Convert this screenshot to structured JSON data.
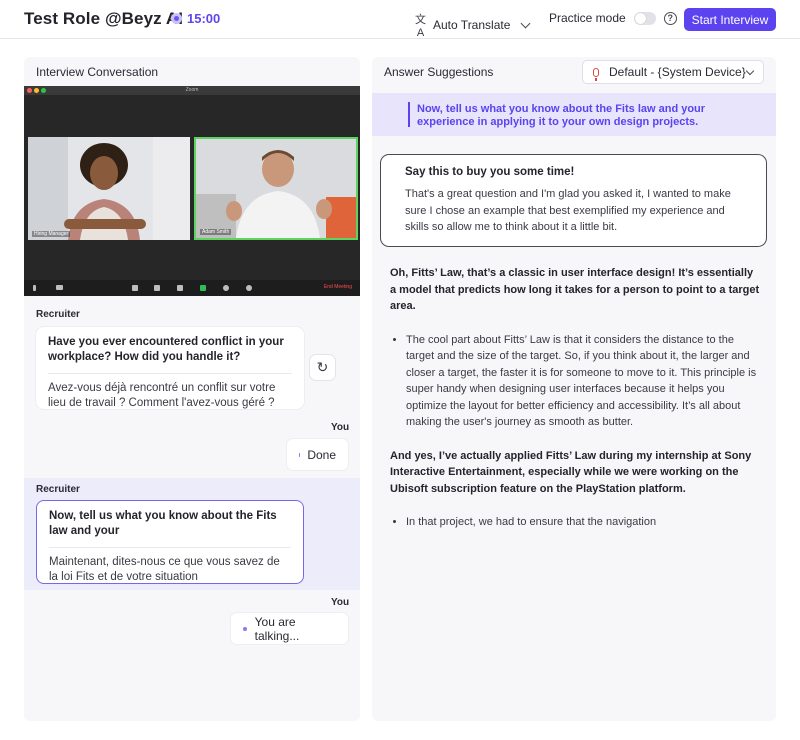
{
  "header": {
    "app_title": "Test Role @Beyz AI",
    "timer": "15:00",
    "translate_label": "Auto Translate",
    "practice_label": "Practice mode",
    "help_icon": "question-circle-icon",
    "start_button": "Start Interview",
    "accent_color": "#5b43f0"
  },
  "conversation": {
    "title": "Interview Conversation",
    "zoom": {
      "window_title": "Zoom",
      "participant_left": "Hiring Manager",
      "participant_right": "Adam Smith",
      "end_label": "End Meeting"
    },
    "messages": [
      {
        "speaker": "Recruiter",
        "question": "Have you ever encountered conflict in your workplace? How did you handle it?",
        "translation": "Avez-vous déjà rencontré un conflit sur votre lieu de travail ? Comment l'avez-vous géré ?"
      },
      {
        "speaker": "You",
        "text": "Done"
      },
      {
        "speaker": "Recruiter",
        "question": "Now, tell us what you know about the Fits law and your",
        "translation": "Maintenant, dites-nous ce que vous savez de la loi Fits et de votre situation"
      },
      {
        "speaker": "You",
        "text": "You are talking..."
      }
    ]
  },
  "suggestions": {
    "title": "Answer Suggestions",
    "device": "Default - {System Device}",
    "question": "Now, tell us what you know about the Fits law and your experience in applying it to your own design projects.",
    "stall_title": "Say this to buy you some time!",
    "stall_body": "That's a great question and I'm glad you asked it, I wanted to make sure I chose an example that best exemplified my experience and skills so allow me to think about it a little bit.",
    "para1": "Oh, Fitts’ Law, that’s a classic in user interface design! It’s essentially a model that predicts how long it takes for a person to point to a target area.",
    "bullet1": "The cool part about Fitts’ Law is that it considers the distance to the target and the size of the target. So, if you think about it, the larger and closer a target, the faster it is for someone to move to it. This principle is super handy when designing user interfaces because it helps you optimize the layout for better efficiency and accessibility. It’s all about making the user's journey as smooth as butter.",
    "para2": "And yes, I’ve actually applied Fitts’ Law during my internship at Sony Interactive Entertainment, especially while we were working on the Ubisoft subscription feature on the PlayStation platform.",
    "bullet2": "In that project, we had to ensure that the navigation"
  }
}
